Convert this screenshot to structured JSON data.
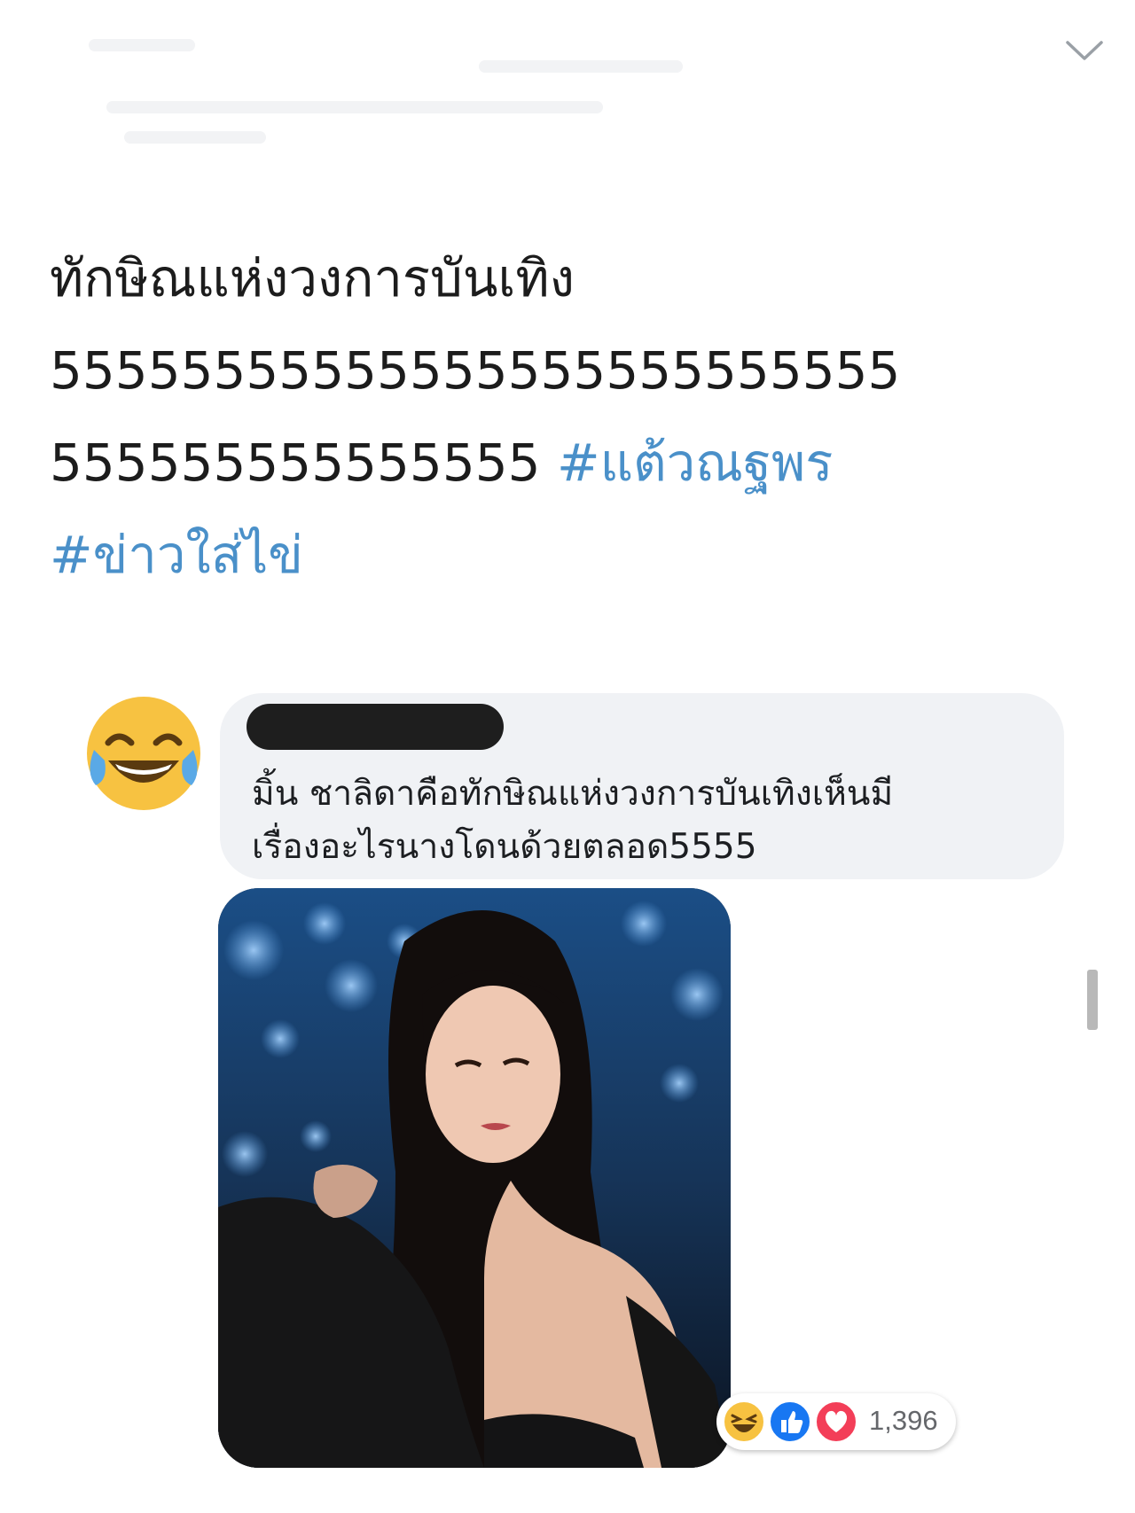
{
  "tweet": {
    "lines": [
      "ทักษิณแห่งวงการบันเทิง",
      "55555555555555555555555555"
    ],
    "line3_text": "555555555555555",
    "hashtags": [
      "#แต้วณฐพร",
      "#ข่าวใส่ไข่"
    ]
  },
  "comment": {
    "text_line1": "มิ้น ชาลิดาคือทักษิณแห่งวงการบันเทิงเห็นมี",
    "text_line2": "เรื่องอะไรนางโดนด้วยตลอด5555",
    "reaction_count": "1,396",
    "reaction_icons": [
      "haha-icon",
      "like-icon",
      "love-icon"
    ]
  },
  "colors": {
    "hashtag": "#4a90c9",
    "bubble": "#f0f2f5",
    "like": "#1877f2",
    "love": "#f33e58",
    "haha": "#f7c241"
  }
}
